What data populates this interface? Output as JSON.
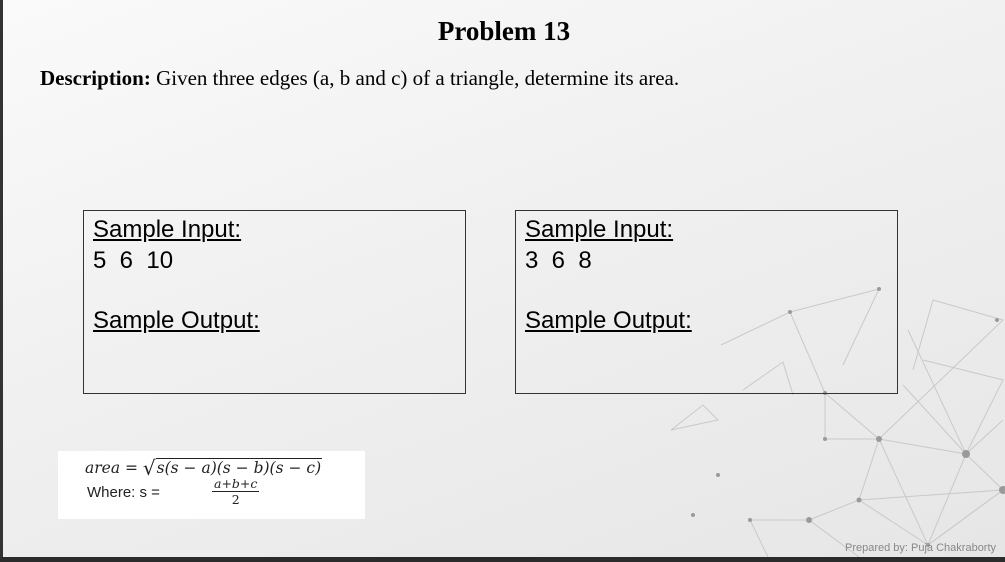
{
  "slide": {
    "title": "Problem 13",
    "description_label": "Description:",
    "description_text": " Given three edges (a, b and c) of a triangle, determine its area."
  },
  "samples": [
    {
      "input_label": "Sample Input:",
      "input_values": "5  6  10",
      "output_label": "Sample Output:"
    },
    {
      "input_label": "Sample Input:",
      "input_values": "3  6  8",
      "output_label": "Sample Output:"
    }
  ],
  "formula": {
    "area_lhs": "area = ",
    "sqrt_symbol": "√",
    "radicand": "s(s − a)(s − b)(s − c)",
    "where_label": "Where: s = ",
    "numerator": "a+b+c",
    "denominator": "2"
  },
  "footer": {
    "credit": "Prepared by: Puja Chakraborty"
  }
}
